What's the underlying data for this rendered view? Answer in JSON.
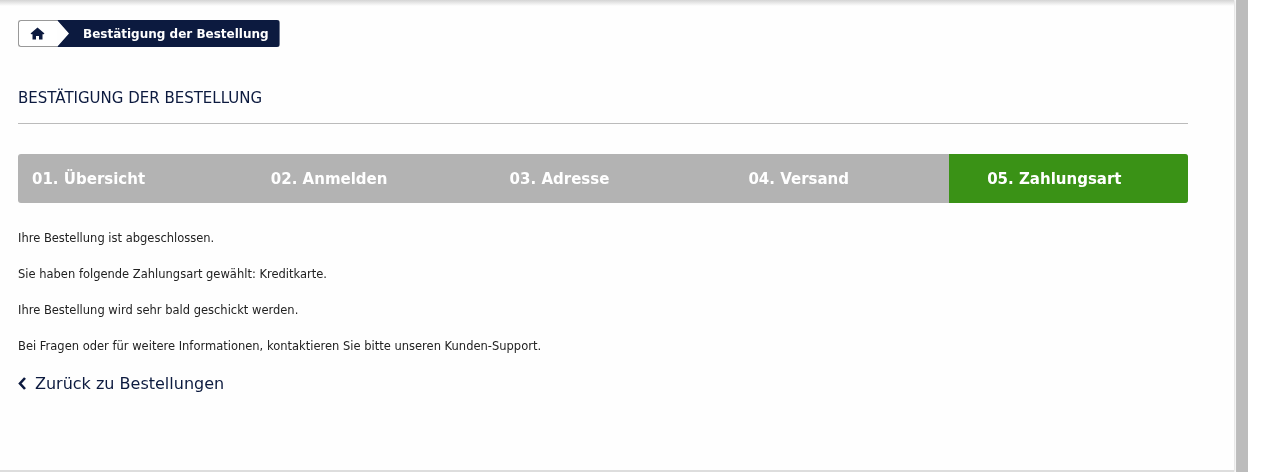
{
  "breadcrumb": {
    "current": "Bestätigung der Bestellung"
  },
  "heading": "BESTÄTIGUNG DER BESTELLUNG",
  "steps": [
    {
      "label": "01. Übersicht",
      "selected": false
    },
    {
      "label": "02. Anmelden",
      "selected": false
    },
    {
      "label": "03. Adresse",
      "selected": false
    },
    {
      "label": "04. Versand",
      "selected": false
    },
    {
      "label": "05. Zahlungsart",
      "selected": true
    }
  ],
  "messages": [
    "Ihre Bestellung ist abgeschlossen.",
    "Sie haben folgende Zahlungsart gewählt: Kreditkarte.",
    "Ihre Bestellung wird sehr bald geschickt werden.",
    "Bei Fragen oder für weitere Informationen, kontaktieren Sie bitte unseren Kunden-Support."
  ],
  "back_link": "Zurück zu Bestellungen"
}
